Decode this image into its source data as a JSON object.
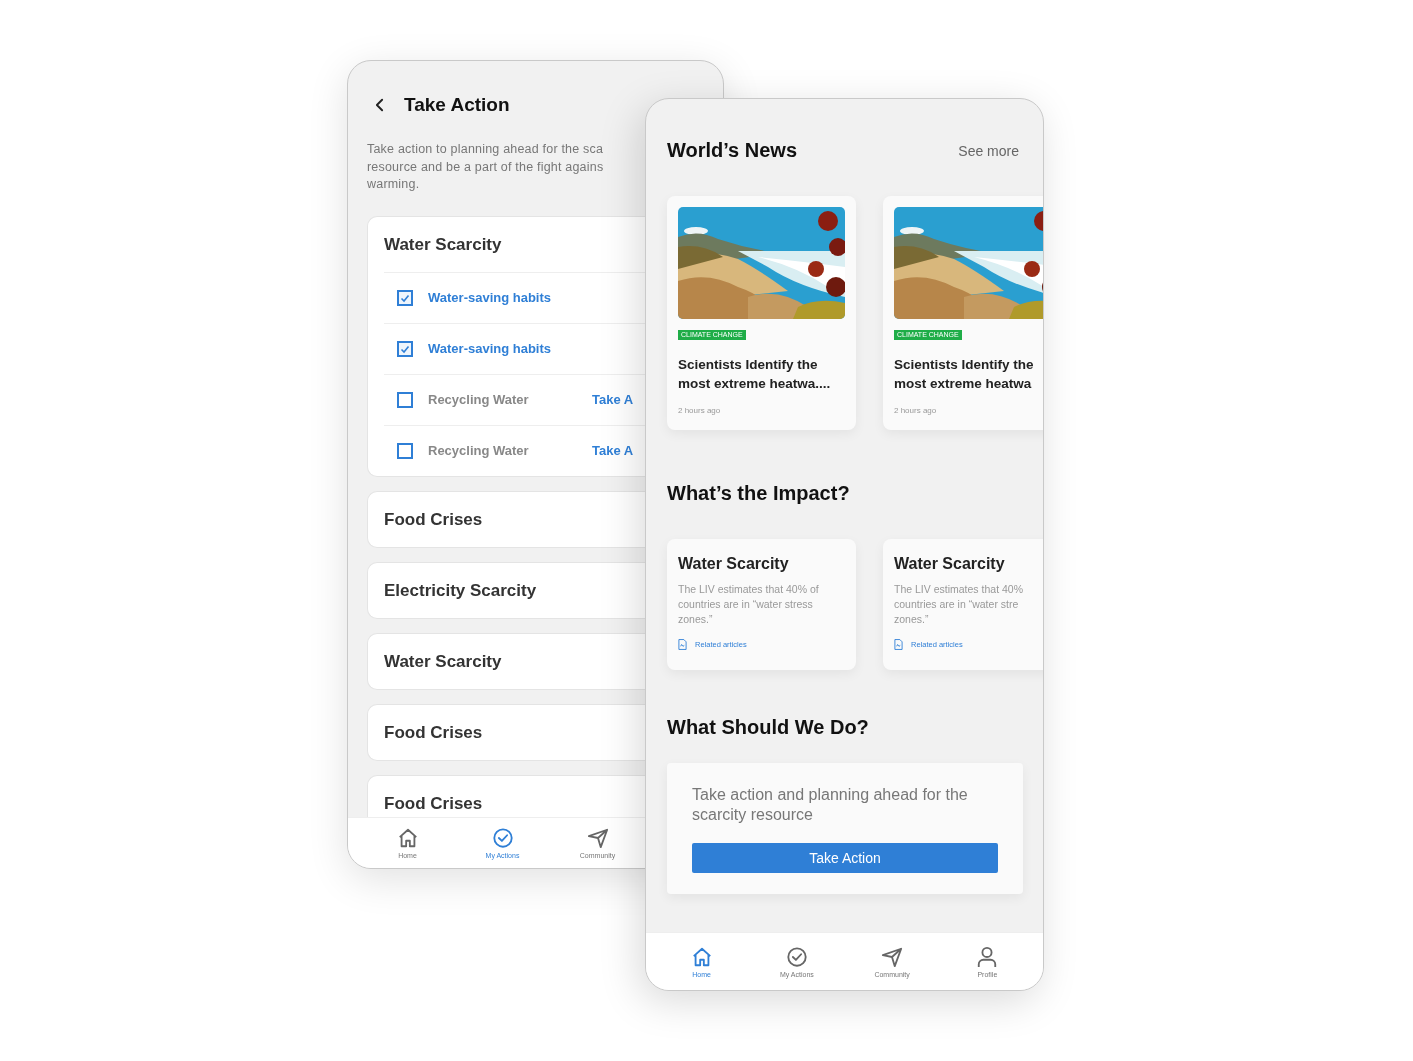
{
  "back_screen": {
    "title": "Take Action",
    "description_lines": [
      "Take action to planning ahead for the sca",
      "resource and be a part of the fight agains",
      "warming."
    ],
    "groups": [
      {
        "title": "Water Scarcity",
        "expanded": true,
        "tasks": [
          {
            "label": "Water-saving habits",
            "checked": true
          },
          {
            "label": "Water-saving habits",
            "checked": true
          },
          {
            "label": "Recycling Water",
            "checked": false,
            "action": "Take A"
          },
          {
            "label": "Recycling Water",
            "checked": false,
            "action": "Take A"
          }
        ]
      },
      {
        "title": "Food Crises",
        "expanded": false
      },
      {
        "title": "Electricity Scarcity",
        "expanded": false
      },
      {
        "title": "Water Scarcity",
        "expanded": false
      },
      {
        "title": "Food Crises",
        "expanded": false
      },
      {
        "title": "Food Crises",
        "expanded": false
      }
    ],
    "nav": [
      {
        "label": "Home",
        "selected": false
      },
      {
        "label": "My Actions",
        "selected": true
      },
      {
        "label": "Community",
        "selected": false
      }
    ]
  },
  "front_screen": {
    "news": {
      "title": "World’s News",
      "link": "See more",
      "articles": [
        {
          "kind": "picture",
          "tag": "CLIMATE CHANGE",
          "title_lines": [
            "Scientists Identify the",
            "most extreme heatwa...."
          ],
          "time": "2 hours ago"
        },
        {
          "kind": "picture",
          "tag": "CLIMATE CHANGE",
          "title_lines": [
            "Scientists Identify the",
            "most extreme heatwa"
          ],
          "time": "2 hours ago"
        }
      ]
    },
    "impact": {
      "title": "What’s the Impact?",
      "cards": [
        {
          "title": "Water Scarcity",
          "text_lines": [
            "The LIV estimates that 40% of",
            "countries are in “water stress",
            "zones.”"
          ],
          "link": "Related articles"
        },
        {
          "title": "Water Scarcity",
          "text_lines": [
            "The LIV estimates that 40%",
            "countries are in “water stre",
            "zones.”"
          ],
          "link": "Related articles"
        }
      ]
    },
    "todo": {
      "title": "What Should We Do?",
      "text": "Take action and planning ahead for the scarcity resource",
      "button": "Take Action"
    },
    "nav": [
      {
        "label": "Home",
        "selected": true
      },
      {
        "label": "My Actions",
        "selected": false
      },
      {
        "label": "Community",
        "selected": false
      },
      {
        "label": "Profile",
        "selected": false
      }
    ]
  }
}
